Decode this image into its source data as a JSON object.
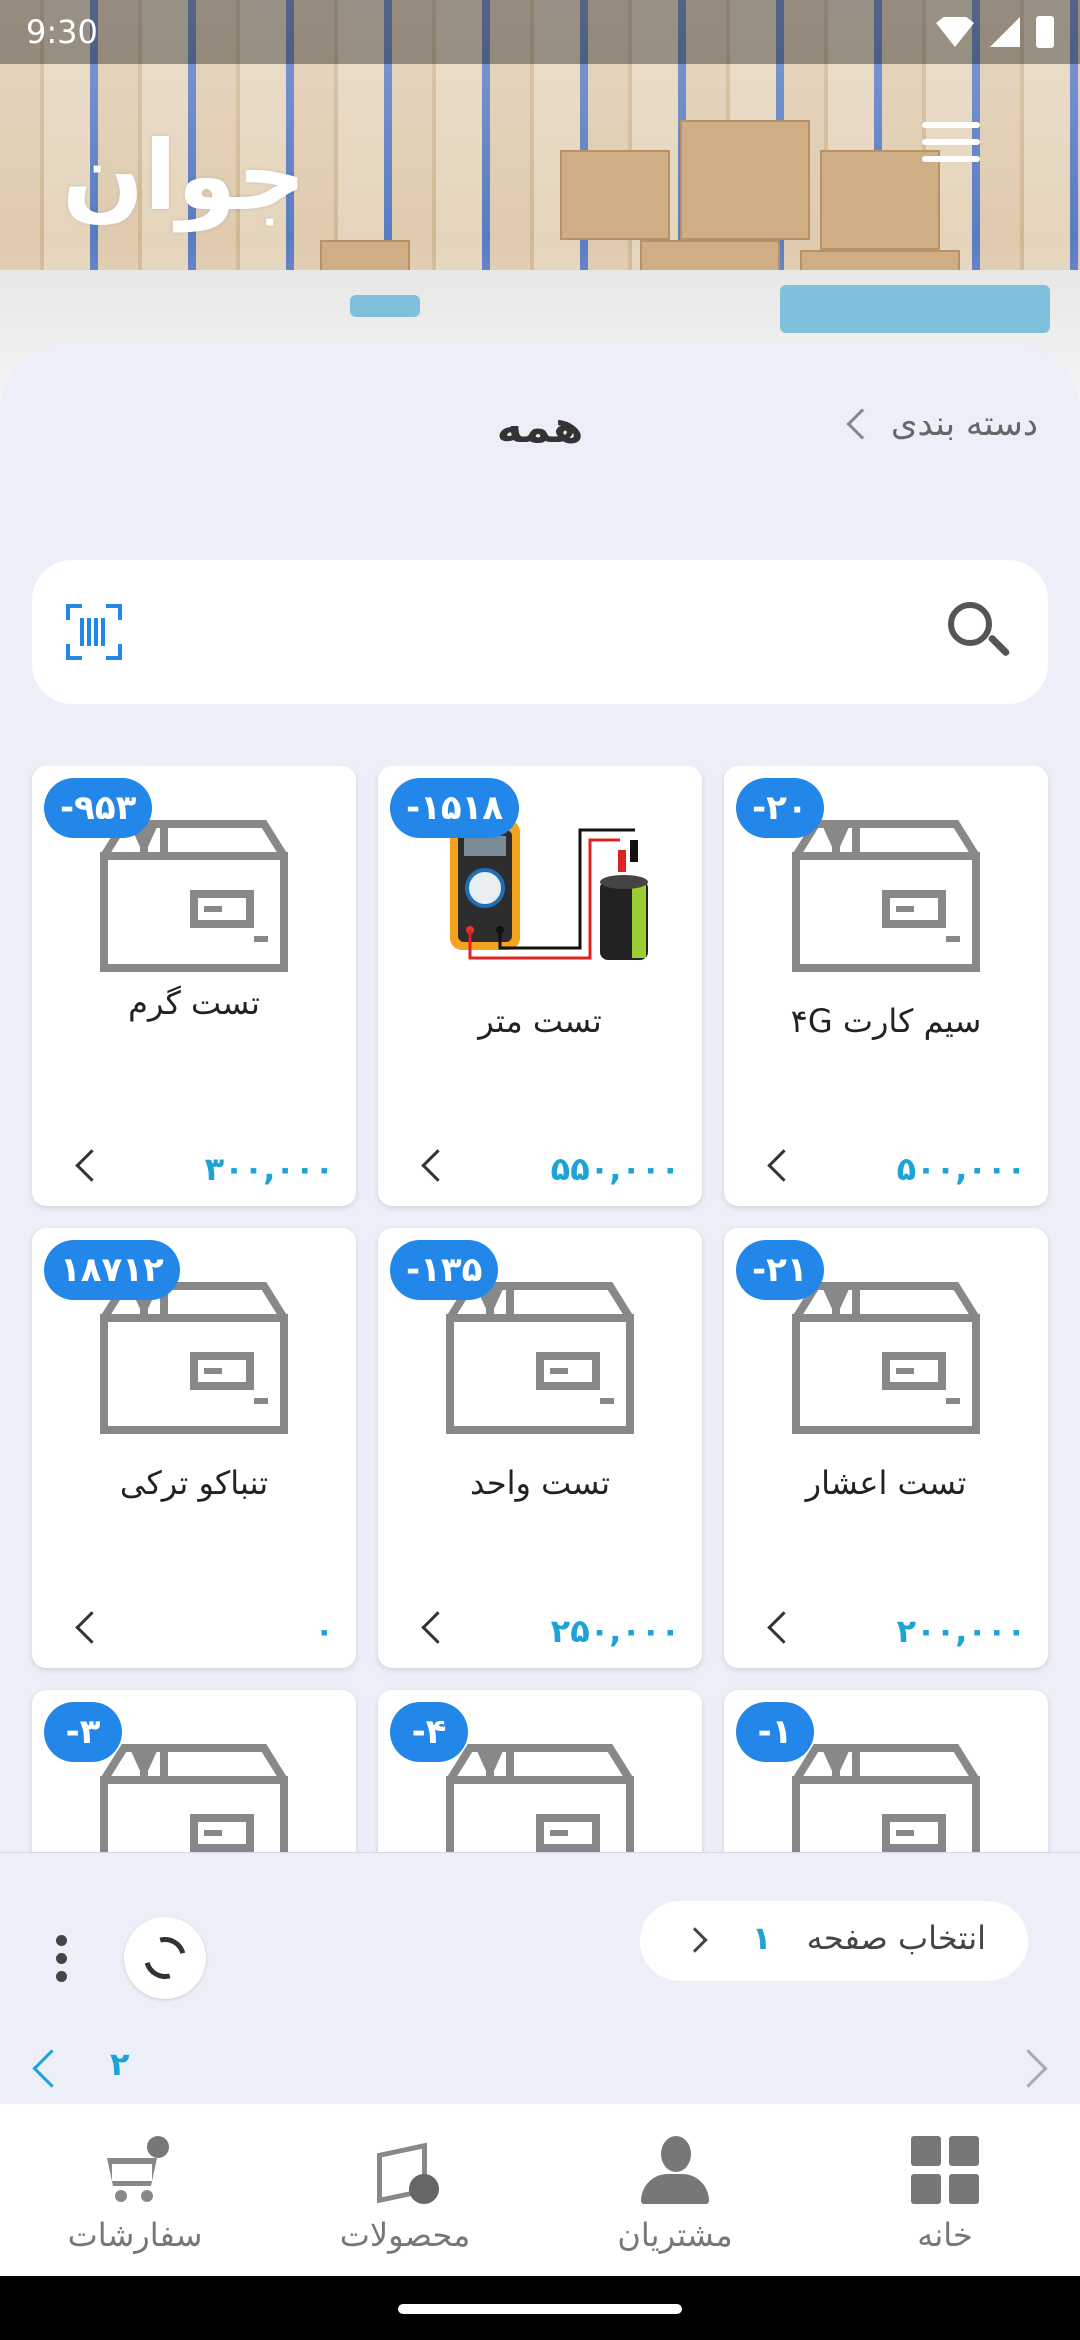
{
  "status_bar": {
    "time": "9:30"
  },
  "header": {
    "logo_text": "جوان"
  },
  "page": {
    "title": "همه",
    "category_label": "دسته بندی"
  },
  "search": {
    "placeholder": ""
  },
  "products": [
    {
      "badge": "-۲۰",
      "name": "سیم کارت ۴G",
      "price": "۵۰۰,۰۰۰",
      "image": "box-icon"
    },
    {
      "badge": "-۱۵۱۸",
      "name": "تست متر",
      "price": "۵۵۰,۰۰۰",
      "image": "multimeter-photo"
    },
    {
      "badge": "-۹۵۳",
      "name": "تست گرم",
      "price": "۳۰۰,۰۰۰",
      "image": "box-icon"
    },
    {
      "badge": "-۲۱",
      "name": "تست اعشار",
      "price": "۲۰۰,۰۰۰",
      "image": "box-icon"
    },
    {
      "badge": "-۱۳۵",
      "name": "تست واحد",
      "price": "۲۵۰,۰۰۰",
      "image": "box-icon"
    },
    {
      "badge": "۱۸۷۱۲",
      "name": "تنباکو ترکی",
      "price": "۰",
      "image": "box-icon"
    },
    {
      "badge": "-۱",
      "name": "",
      "price": "",
      "image": "box-icon"
    },
    {
      "badge": "-۴",
      "name": "",
      "price": "",
      "image": "box-icon"
    },
    {
      "badge": "-۳",
      "name": "",
      "price": "",
      "image": "box-icon"
    }
  ],
  "pagination": {
    "select_label": "انتخاب صفحه",
    "current_page": "۱",
    "next_page": "۲"
  },
  "bottom_nav": [
    {
      "label": "خانه",
      "icon": "home-grid-icon"
    },
    {
      "label": "مشتریان",
      "icon": "customers-icon"
    },
    {
      "label": "محصولات",
      "icon": "products-icon"
    },
    {
      "label": "سفارشات",
      "icon": "orders-cart-icon"
    }
  ],
  "colors": {
    "accent": "#2287e9",
    "price": "#1ea3d6",
    "background": "#eceef8"
  }
}
